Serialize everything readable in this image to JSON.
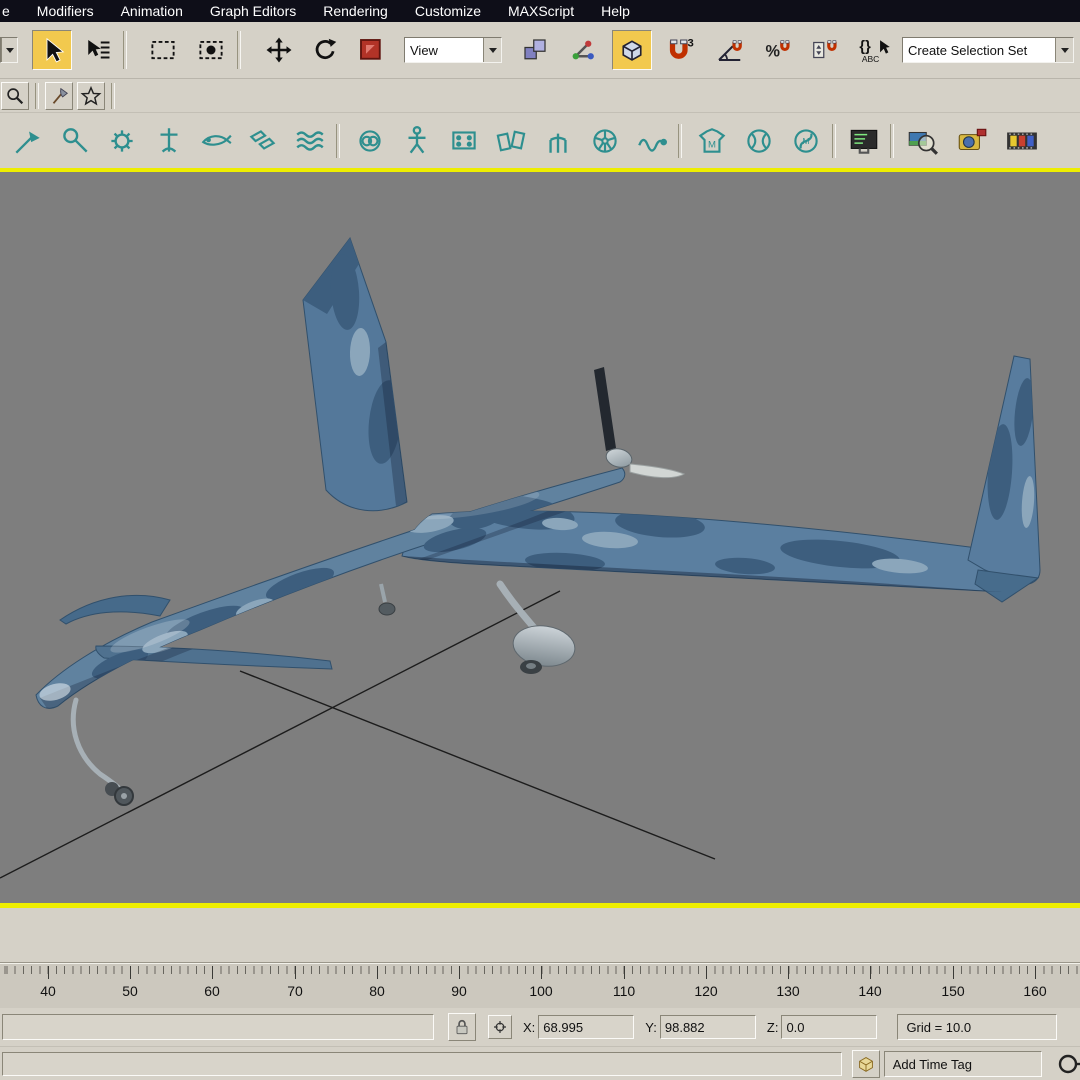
{
  "menu_bar": {
    "items": [
      "e",
      "Modifiers",
      "Animation",
      "Graph Editors",
      "Rendering",
      "Customize",
      "MAXScript",
      "Help"
    ]
  },
  "main_toolbar": {
    "view_dropdown_value": "View",
    "selection_set_value": "Create Selection Set",
    "snap_superscript": "3",
    "percent_label": "%",
    "named_sets_brace": "{}",
    "named_sets_abc": "ABC"
  },
  "toolbar3": {
    "shirt_letter": "M",
    "galaxy_letter": "M"
  },
  "timeline": {
    "tick_labels": [
      "40",
      "50",
      "60",
      "70",
      "80",
      "90",
      "100",
      "110",
      "120",
      "130",
      "140",
      "150",
      "160"
    ]
  },
  "status_bar": {
    "prompt_text": "",
    "x_label": "X:",
    "x_value": "68.995",
    "y_label": "Y:",
    "y_value": "98.882",
    "z_label": "Z:",
    "z_value": "0.0",
    "grid_readout": "Grid = 10.0"
  },
  "bottom_bar": {
    "status_text": "",
    "add_time_tag_label": "Add Time Tag"
  },
  "colors": {
    "menu_bg": "#0e0e18",
    "toolbar_bg": "#d5d1c7",
    "viewport_bg": "#7e7e7e",
    "active_viewport_border": "#eeee00",
    "active_button": "#f2c94e",
    "teal_icon": "#2e8f8f",
    "aircraft_base": "#5b7fa0",
    "aircraft_camo_dark": "#3d5e7e",
    "aircraft_camo_light": "#8aa5ba"
  },
  "icons": {
    "select-arrow-icon": "black cursor arrow",
    "select-by-name-icon": "cursor with list lines",
    "rect-selection-region-icon": "dashed rectangle",
    "window-crossing-icon": "dashed rectangle with dot",
    "move-icon": "four-way arrow cross",
    "rotate-icon": "circular arrow",
    "scale-icon": "red square",
    "use-center-icon": "stacked cubes",
    "manipulate-icon": "axis with colored handles",
    "snaps-cube-icon": "3d cube",
    "magnet-icon": "red horseshoe magnet",
    "zoom-icon": "magnifier",
    "star-icon": "star outline",
    "lock-icon": "padlock",
    "absolute-offset-icon": "crosshair circle",
    "time-tag-cube-icon": "isometric cube",
    "pan-circle-icon": "circle with handle"
  }
}
